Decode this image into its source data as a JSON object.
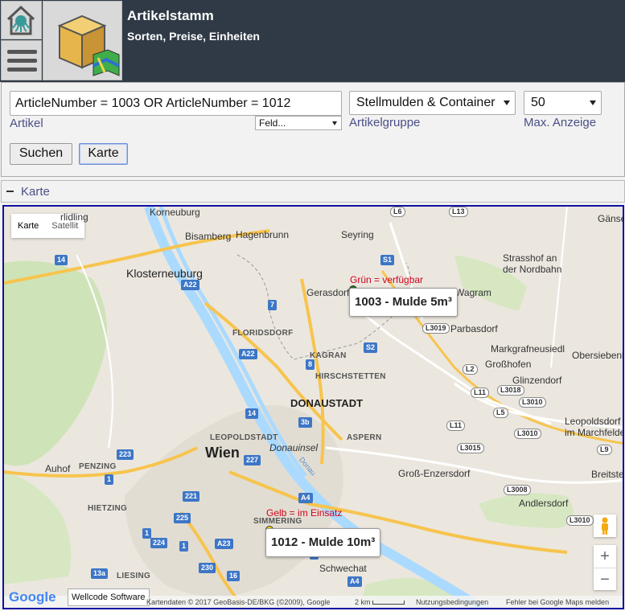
{
  "header": {
    "title": "Artikelstamm",
    "subtitle": "Sorten, Preise, Einheiten",
    "home_icon": "home-octopus-icon",
    "menu_icon": "hamburger-icon",
    "logo_icon": "box-map-icon",
    "bg_color": "#2f3a46"
  },
  "form": {
    "query_value": "ArticleNumber = 1003 OR ArticleNumber = 1012",
    "field_select_value": "Feld...",
    "artikel_label": "Artikel",
    "artikelgruppe_value": "Stellmulden & Container",
    "artikelgruppe_label": "Artikelgruppe",
    "max_value": "50",
    "max_label": "Max. Anzeige",
    "search_button": "Suchen",
    "map_button": "Karte"
  },
  "section": {
    "title": "Karte",
    "collapse_icon": "minus-icon"
  },
  "map": {
    "map_type": {
      "map": "Karte",
      "satellite": "Satellit"
    },
    "places": {
      "korneuburg": "Korneuburg",
      "bisamberg": "Bisamberg",
      "hagenbrunn": "Hagenbrunn",
      "seyring": "Seyring",
      "klosterneuburg": "Klosterneuburg",
      "gerasdorf": "Gerasdorf bei Wien",
      "deutsch_wagram": "Deutsch-Wagram",
      "strasshof": "Strasshof an der Nordbahn",
      "parbasdorf": "Parbasdorf",
      "markgrafneusiedl": "Markgrafneusiedl",
      "grosshofen": "Großhofen",
      "obersiebenbrunn": "Obersiebenbrunn",
      "glinzendorf": "Glinzendorf",
      "kagran": "KAGRAN",
      "hirschstetten": "HIRSCHSTETTEN",
      "floridsdorf": "FLORIDSDORF",
      "donaustadt": "DONAUSTADT",
      "aspern": "ASPERN",
      "leopoldstadt": "LEOPOLDSTADT",
      "wien": "Wien",
      "donauinsel": "Donauinsel",
      "leopoldsdorf": "Leopoldsdorf im Marchfelde",
      "penzing": "PENZING",
      "auhof": "Auhof",
      "gross_enzersdorf": "Groß-Enzersdorf",
      "breitstett": "Breitste",
      "hietzing": "HIETZING",
      "simmering": "SIMMERING",
      "andlersdorf": "Andlersdorf",
      "liesing": "LIESING",
      "schwechat": "Schwechat",
      "weidling": "rlidling",
      "ganser": "Gänse",
      "donau": "Donau"
    },
    "markers": [
      {
        "label": "1003 - Mulde 5m³",
        "status": "Grün = verfügbar",
        "color": "#1e7d1e"
      },
      {
        "label": "1012 - Mulde 10m³",
        "status": "Gelb = im Einsatz",
        "color": "#f5d800"
      }
    ],
    "shields": [
      "L6",
      "L13",
      "14",
      "A22",
      "S1",
      "7",
      "A22",
      "8",
      "S2",
      "L3019",
      "L2",
      "L11",
      "L3018",
      "L3010",
      "L5",
      "L3010",
      "L11",
      "L3015",
      "L9",
      "L3008",
      "L3010",
      "14",
      "3b",
      "227",
      "223",
      "1",
      "221",
      "A4",
      "225",
      "224",
      "A23",
      "1",
      "1",
      "13a",
      "230",
      "16",
      "A4",
      "1"
    ],
    "footer": {
      "attribution": "Kartendaten © 2017 GeoBasis-DE/BKG (©2009), Google",
      "scale": "2 km",
      "terms": "Nutzungsbedingungen",
      "report": "Fehler bei Google Maps melden",
      "google": "Google",
      "wellcode": "Wellcode Software"
    }
  }
}
